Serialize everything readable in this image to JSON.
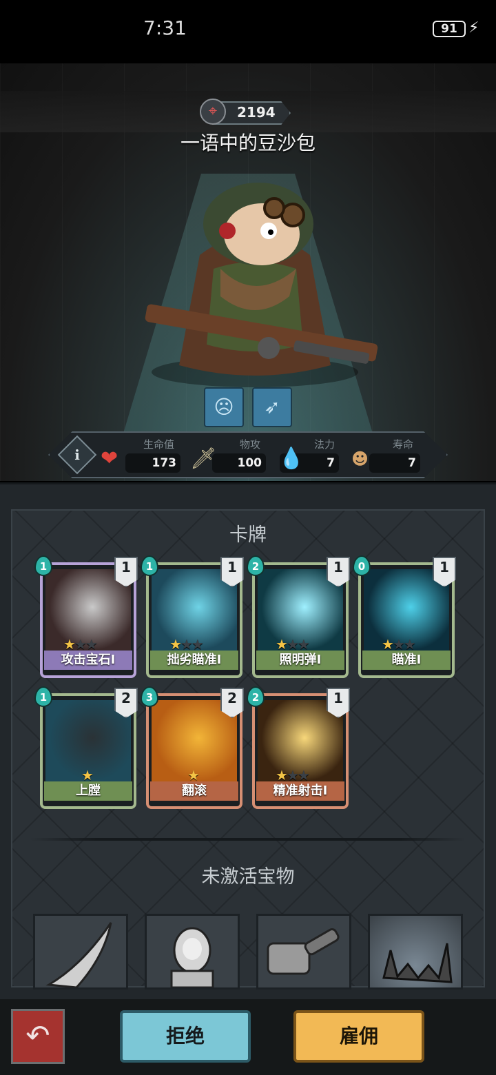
{
  "status_bar": {
    "time": "7:31",
    "battery": "91"
  },
  "hero": {
    "power": "2194",
    "name": "一语中的豆沙包"
  },
  "skills": [
    {
      "icon": "face-mask-skill-icon"
    },
    {
      "icon": "bow-skill-icon"
    }
  ],
  "stats": [
    {
      "label": "生命值",
      "value": "173",
      "icon": "heart-icon",
      "color": "#e0443c"
    },
    {
      "label": "物攻",
      "value": "100",
      "icon": "sword-icon",
      "color": "#d0c49a"
    },
    {
      "label": "法力",
      "value": "7",
      "icon": "flame-icon",
      "color": "#36c9bd"
    },
    {
      "label": "寿命",
      "value": "7",
      "icon": "lifespan-icon",
      "color": "#d7a56b"
    }
  ],
  "cards_title": "卡牌",
  "cards": [
    {
      "name": "攻击宝石I",
      "cost": "1",
      "count": "1",
      "stars": 1,
      "frame": "#b7a3d8",
      "label_bg": "#8d7ab7"
    },
    {
      "name": "拙劣瞄准I",
      "cost": "1",
      "count": "1",
      "stars": 1,
      "frame": "#a4b98e",
      "label_bg": "#6f8f53"
    },
    {
      "name": "照明弹I",
      "cost": "2",
      "count": "1",
      "stars": 1,
      "frame": "#a4b98e",
      "label_bg": "#6f8f53"
    },
    {
      "name": "瞄准I",
      "cost": "0",
      "count": "1",
      "stars": 1,
      "frame": "#a4b98e",
      "label_bg": "#6f8f53"
    },
    {
      "name": "上膛",
      "cost": "1",
      "count": "2",
      "stars": 1,
      "frame": "#a4b98e",
      "label_bg": "#6f8f53"
    },
    {
      "name": "翻滚",
      "cost": "3",
      "count": "2",
      "stars": 1,
      "frame": "#d68f73",
      "label_bg": "#b56545"
    },
    {
      "name": "精准射击I",
      "cost": "2",
      "count": "1",
      "stars": 1,
      "frame": "#d68f73",
      "label_bg": "#b56545"
    }
  ],
  "treasures_title": "未激活宝物",
  "treasures": [
    {
      "icon": "blade-icon"
    },
    {
      "icon": "doll-icon"
    },
    {
      "icon": "hammer-icon"
    },
    {
      "icon": "trap-icon"
    }
  ],
  "buttons": {
    "reject": "拒绝",
    "hire": "雇佣"
  }
}
